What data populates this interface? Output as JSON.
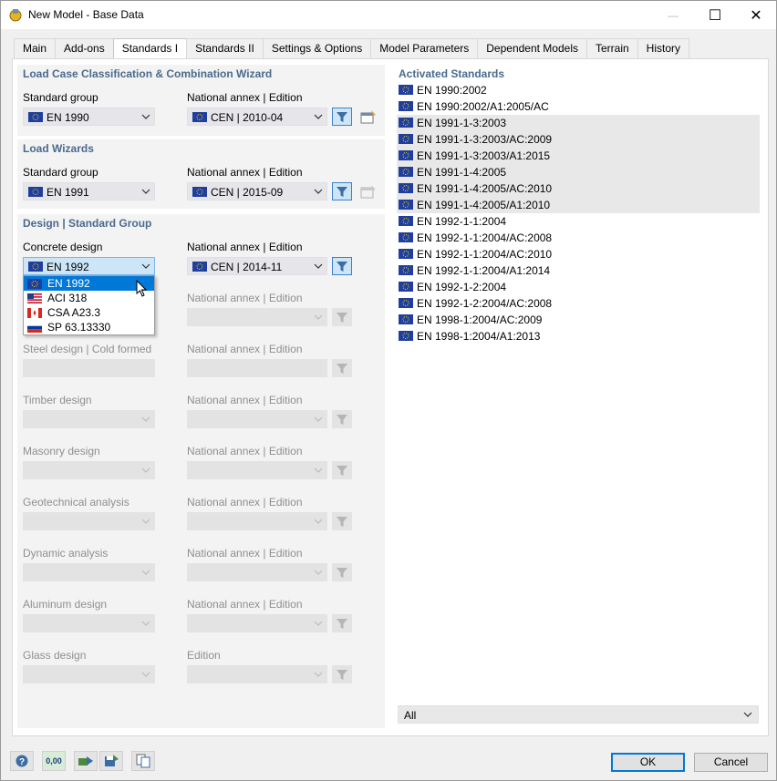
{
  "window": {
    "title": "New Model - Base Data",
    "minimize": "—",
    "maximize": "☐",
    "close": "✕"
  },
  "tabs": [
    "Main",
    "Add-ons",
    "Standards I",
    "Standards II",
    "Settings & Options",
    "Model Parameters",
    "Dependent Models",
    "Terrain",
    "History"
  ],
  "active_tab": "Standards I",
  "lcc": {
    "title": "Load Case Classification & Combination Wizard",
    "group_label": "Standard group",
    "group_value": "EN 1990",
    "annex_label": "National annex | Edition",
    "annex_value": "CEN | 2010-04"
  },
  "wizards": {
    "title": "Load Wizards",
    "group_label": "Standard group",
    "group_value": "EN 1991",
    "annex_label": "National annex | Edition",
    "annex_value": "CEN | 2015-09"
  },
  "design": {
    "title": "Design | Standard Group",
    "concrete_label": "Concrete design",
    "concrete_value": "EN 1992",
    "concrete_annex_label": "National annex | Edition",
    "concrete_annex_value": "CEN | 2014-11",
    "rows": [
      {
        "label": "",
        "annex": "National annex | Edition"
      },
      {
        "label": "Steel design | Cold formed",
        "annex": "National annex | Edition"
      },
      {
        "label": "Timber design",
        "annex": "National annex | Edition"
      },
      {
        "label": "Masonry design",
        "annex": "National annex | Edition"
      },
      {
        "label": "Geotechnical analysis",
        "annex": "National annex | Edition"
      },
      {
        "label": "Dynamic analysis",
        "annex": "National annex | Edition"
      },
      {
        "label": "Aluminum design",
        "annex": "National annex | Edition"
      },
      {
        "label": "Glass design",
        "annex": "Edition"
      }
    ]
  },
  "dropdown": {
    "items": [
      {
        "label": "EN 1992",
        "flag": "eu"
      },
      {
        "label": "ACI 318",
        "flag": "us"
      },
      {
        "label": "CSA A23.3",
        "flag": "ca"
      },
      {
        "label": "SP 63.13330",
        "flag": "ru"
      }
    ]
  },
  "activated": {
    "title": "Activated Standards",
    "items": [
      "EN 1990:2002",
      "EN 1990:2002/A1:2005/AC",
      "EN 1991-1-3:2003",
      "EN 1991-1-3:2003/AC:2009",
      "EN 1991-1-3:2003/A1:2015",
      "EN 1991-1-4:2005",
      "EN 1991-1-4:2005/AC:2010",
      "EN 1991-1-4:2005/A1:2010",
      "EN 1992-1-1:2004",
      "EN 1992-1-1:2004/AC:2008",
      "EN 1992-1-1:2004/AC:2010",
      "EN 1992-1-1:2004/A1:2014",
      "EN 1992-1-2:2004",
      "EN 1992-1-2:2004/AC:2008",
      "EN 1998-1:2004/AC:2009",
      "EN 1998-1:2004/A1:2013"
    ],
    "filter_value": "All"
  },
  "footer": {
    "ok": "OK",
    "cancel": "Cancel",
    "units_icon_text": "0,00"
  },
  "colors": {
    "accent": "#0078d7",
    "panel_title": "#4a6a8e",
    "eu_flag": "#1f3fa0"
  }
}
